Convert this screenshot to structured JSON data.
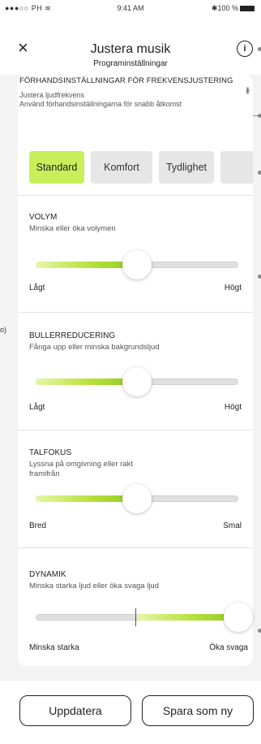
{
  "status": {
    "left": "PH",
    "time": "9:41 AM",
    "right": "100 %"
  },
  "header": {
    "close": "×",
    "title": "Justera musik",
    "subtitle": "Programinställningar",
    "info": "i"
  },
  "presets_section": {
    "heading": "FÖRHANDSINSTÄLLNINGAR FÖR FREKVENSJUSTERING",
    "eq_icon": "⫵",
    "line1": "Justera ljudfrekvens",
    "line2": "Använd förhandsinställningarna för snabb åtkomst",
    "chips": [
      "Standard",
      "Komfort",
      "Tydlighet",
      ""
    ]
  },
  "volume": {
    "title": "VOLYM",
    "subtitle": "Minska eller öka volymen",
    "min": "Lågt",
    "max": "Högt",
    "level": 0.5
  },
  "noise": {
    "title": "BULLERREDUCERING",
    "subtitle": "Fånga upp eller minska bakgrundsljud",
    "min": "Lågt",
    "max": "Högt",
    "level": 0.5
  },
  "speech": {
    "title": "TALFOKUS",
    "subtitle": "Lyssna på omgivning eller rakt framifrån",
    "min": "Bred",
    "max": "Smal",
    "level": 0.5
  },
  "dynamics": {
    "title": "DYNAMIK",
    "subtitle": "Minska starka ljud eller öka svaga ljud",
    "min": "Minska starka",
    "max": "Öka svaga",
    "level": 1.0
  },
  "side_label": "o)",
  "buttons": {
    "update": "Uppdatera",
    "save_new": "Spara som ny"
  },
  "colors": {
    "accent": "#c8ef5a",
    "slider_fill": "#8fc922"
  }
}
